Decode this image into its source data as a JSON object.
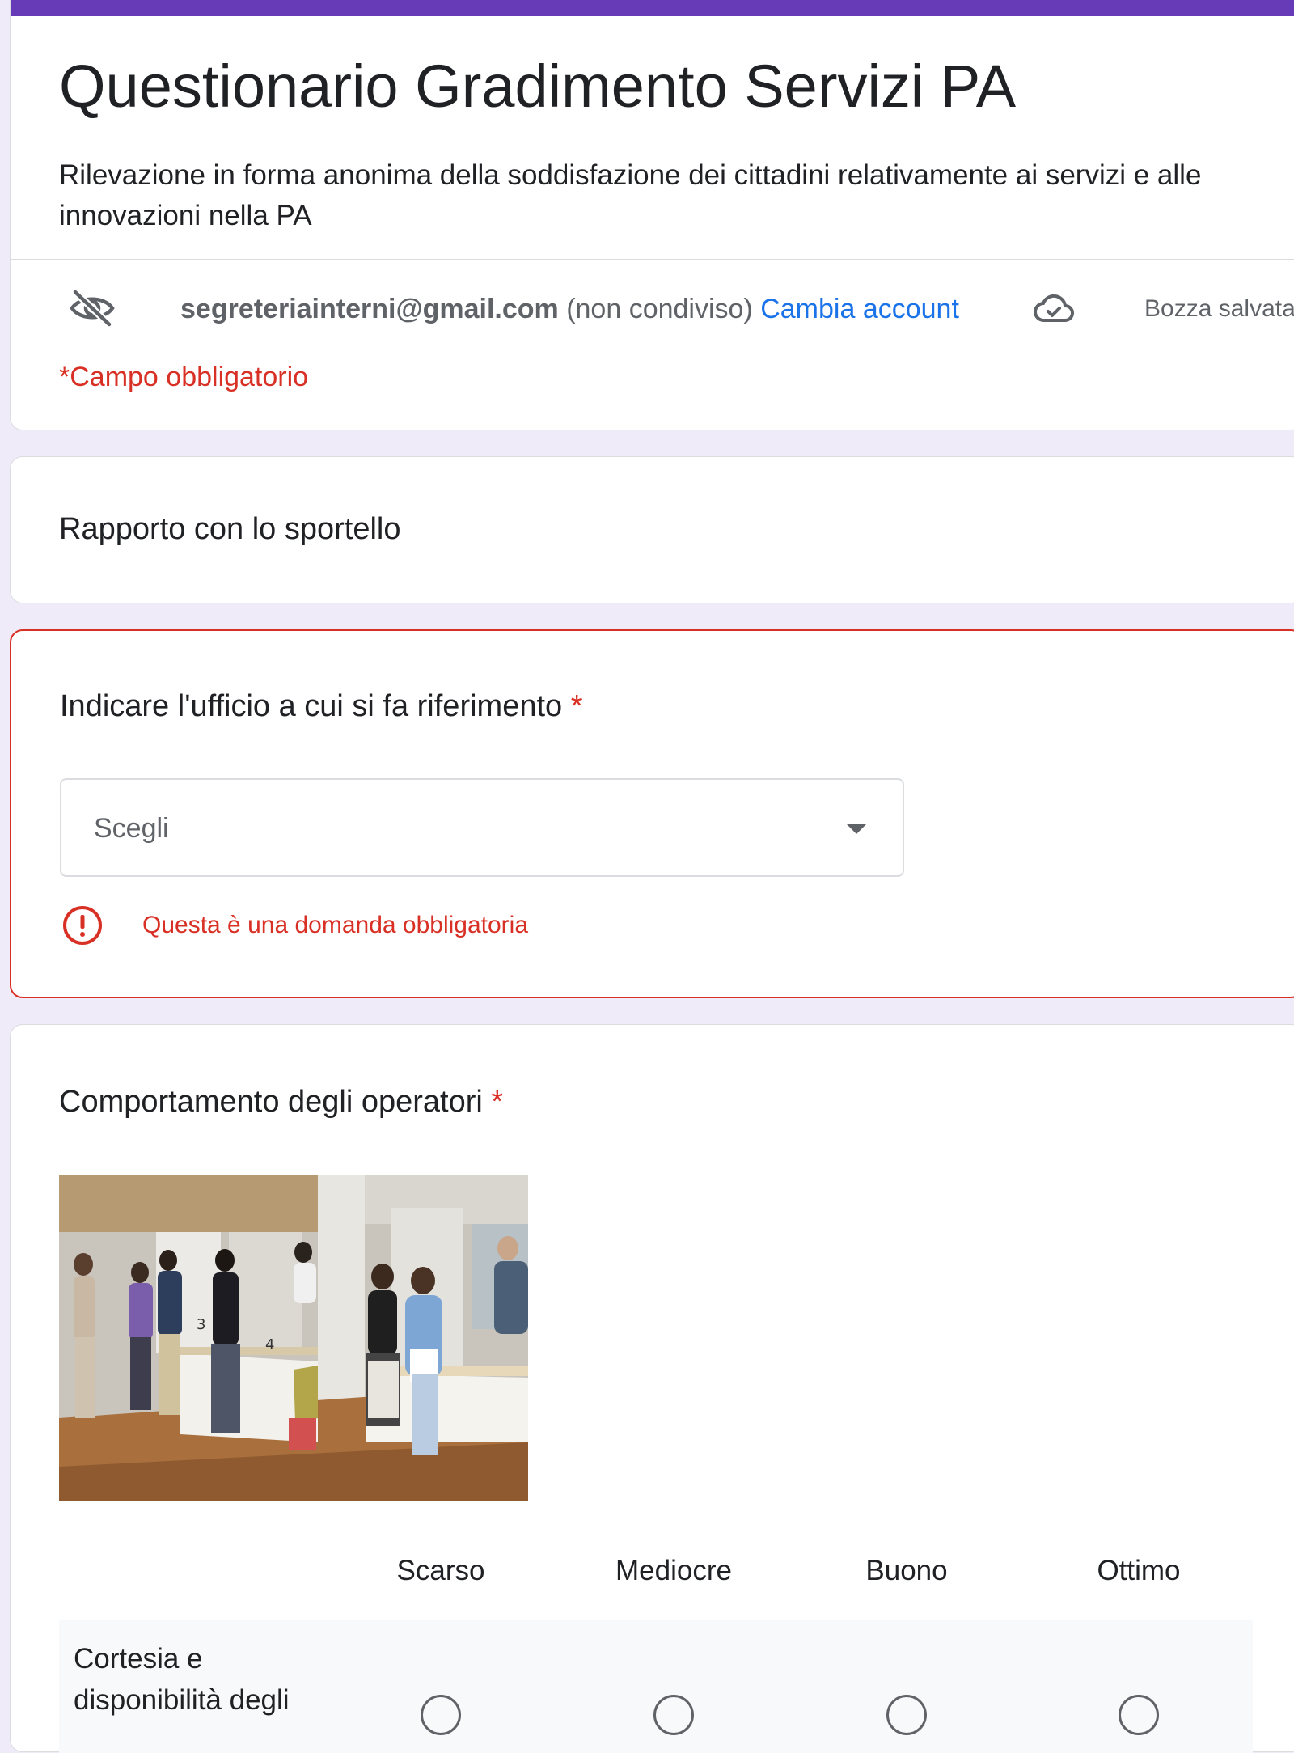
{
  "form": {
    "title": "Questionario Gradimento Servizi PA",
    "description": "Rilevazione in forma anonima della soddisfazione dei cittadini relativamente ai servizi e alle innovazioni nella PA",
    "accent_color": "#673ab7",
    "account": {
      "email": "segreteriainterni@gmail.com",
      "note": "(non condiviso)",
      "switch_label": "Cambia account",
      "visibility_icon": "eye-off-icon"
    },
    "draft_status": {
      "icon": "cloud-check-icon",
      "label": "Bozza salvata"
    },
    "required_note": "*Campo obbligatorio"
  },
  "section": {
    "title": "Rapporto con lo sportello"
  },
  "question_office": {
    "title": "Indicare l'ufficio a cui si fa riferimento",
    "required_mark": "*",
    "select_placeholder": "Scegli",
    "error_message": "Questa è una domanda obbligatoria",
    "error_color": "#d93025"
  },
  "question_behavior": {
    "title": "Comportamento degli operatori",
    "required_mark": "*",
    "columns": [
      "Scarso",
      "Mediocre",
      "Buono",
      "Ottimo"
    ],
    "rows": [
      {
        "label": "Cortesia e disponibilità degli"
      }
    ]
  }
}
